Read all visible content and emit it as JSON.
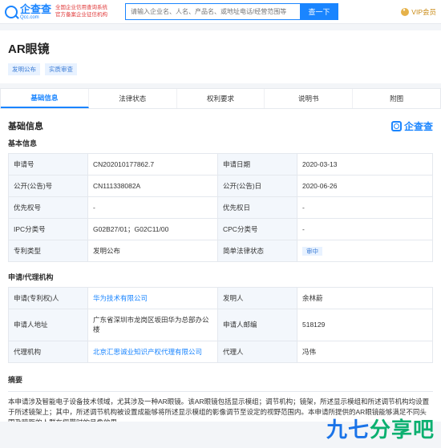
{
  "topbar": {
    "logo_cn": "企查查",
    "logo_en": "Qcc.com",
    "tagline_line1": "全国企业信用查询系统",
    "tagline_line2": "官方备案企业征信机构",
    "search_placeholder": "请输入企业名、人名、产品名、或地址电话/经营范围等",
    "search_button": "查一下",
    "vip_label": "VIP会员"
  },
  "header": {
    "title": "AR眼镜",
    "tags": [
      "发明公布",
      "实质审查"
    ]
  },
  "tabs": [
    "基础信息",
    "法律状态",
    "权利要求",
    "说明书",
    "附图"
  ],
  "active_tab": 0,
  "section": {
    "title": "基础信息",
    "brand": "企查查",
    "basic_subtitle": "基本信息",
    "agency_subtitle": "申请/代理机构",
    "abstract_subtitle": "摘要"
  },
  "basic_info": [
    {
      "k1": "申请号",
      "v1": "CN202010177862.7",
      "k2": "申请日期",
      "v2": "2020-03-13"
    },
    {
      "k1": "公开(公告)号",
      "v1": "CN111338082A",
      "k2": "公开(公告)日",
      "v2": "2020-06-26"
    },
    {
      "k1": "优先权号",
      "v1": "-",
      "k2": "优先权日",
      "v2": "-"
    },
    {
      "k1": "IPC分类号",
      "v1": "G02B27/01；G02C11/00",
      "k2": "CPC分类号",
      "v2": "-"
    },
    {
      "k1": "专利类型",
      "v1": "发明公布",
      "k2": "简单法律状态",
      "v2": "审中"
    }
  ],
  "agency_info": [
    {
      "k1": "申请(专利权)人",
      "v1": "华为技术有限公司",
      "k2": "发明人",
      "v2": "余林蔚"
    },
    {
      "k1": "申请人地址",
      "v1": "广东省深圳市龙岗区坂田华为总部办公楼",
      "k2": "申请人邮编",
      "v2": "518129"
    },
    {
      "k1": "代理机构",
      "v1": "北京汇思诚业知识产权代理有限公司",
      "k2": "代理人",
      "v2": "冯伟"
    }
  ],
  "abstract_text": "本申请涉及智能电子设备技术领域，尤其涉及一种AR眼镜。该AR眼镜包括显示模组；调节机构；镜架，所述显示模组和所述调节机构均设置于所述镜架上；其中，所述调节机构被设置成能够将所述显示模组的影像调节至设定的视野范围内。本申请所提供的AR眼镜能够满足不同头围及瞳距的人群在佩带时的呈像效果。",
  "watermark": {
    "part1": "九七",
    "part2": "分享吧"
  },
  "colors": {
    "accent": "#1a85ff",
    "tag_bg": "#e8f2ff",
    "key_bg": "#f3f7fc"
  }
}
